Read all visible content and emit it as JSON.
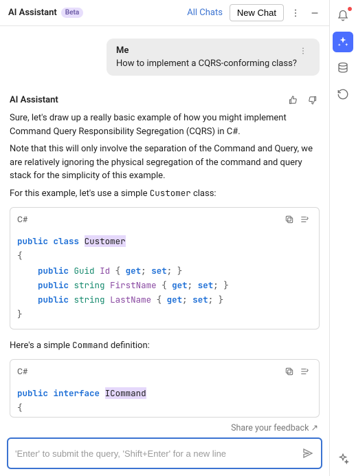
{
  "header": {
    "title": "AI Assistant",
    "badge": "Beta",
    "all_chats": "All Chats",
    "new_chat": "New Chat"
  },
  "right_rail": {
    "items": [
      {
        "name": "notifications",
        "icon": "bell",
        "active": false,
        "dot": true
      },
      {
        "name": "assistant",
        "icon": "sparkle",
        "active": true,
        "dot": false
      },
      {
        "name": "database",
        "icon": "database",
        "active": false,
        "dot": false
      },
      {
        "name": "history",
        "icon": "clock-back",
        "active": false,
        "dot": false
      },
      {
        "name": "sparkle-outline",
        "icon": "sparkle-outline",
        "active": false,
        "dot": false
      }
    ]
  },
  "chat": {
    "user": {
      "name": "Me",
      "text": "How to implement a CQRS-conforming class?"
    },
    "assistant": {
      "name": "AI Assistant",
      "para1": "Sure, let's draw up a really basic example of how you might implement Command Query Responsibility Segregation (CQRS) in C#.",
      "para2": "Note that this will only involve the separation of the Command and Query, we are relatively ignoring the physical segregation of the command and query stack for the simplicity of this example.",
      "para3_pre": "For this example, let's use a simple ",
      "para3_code": "Customer",
      "para3_post": " class:",
      "code1": {
        "lang": "C#",
        "tokens": {
          "public": "public",
          "class": "class",
          "customer": "Customer",
          "guid": "Guid",
          "string": "string",
          "id": "Id",
          "first": "FirstName",
          "last": "LastName",
          "get": "get",
          "set": "set"
        }
      },
      "para4_pre": "Here's a simple ",
      "para4_code": "Command",
      "para4_post": " definition:",
      "code2": {
        "lang": "C#",
        "tokens": {
          "public": "public",
          "interface": "interface",
          "icommand": "ICommand"
        }
      }
    }
  },
  "footer": {
    "feedback": "Share your feedback ↗",
    "placeholder": "'Enter' to submit the query, 'Shift+Enter' for a new line"
  }
}
